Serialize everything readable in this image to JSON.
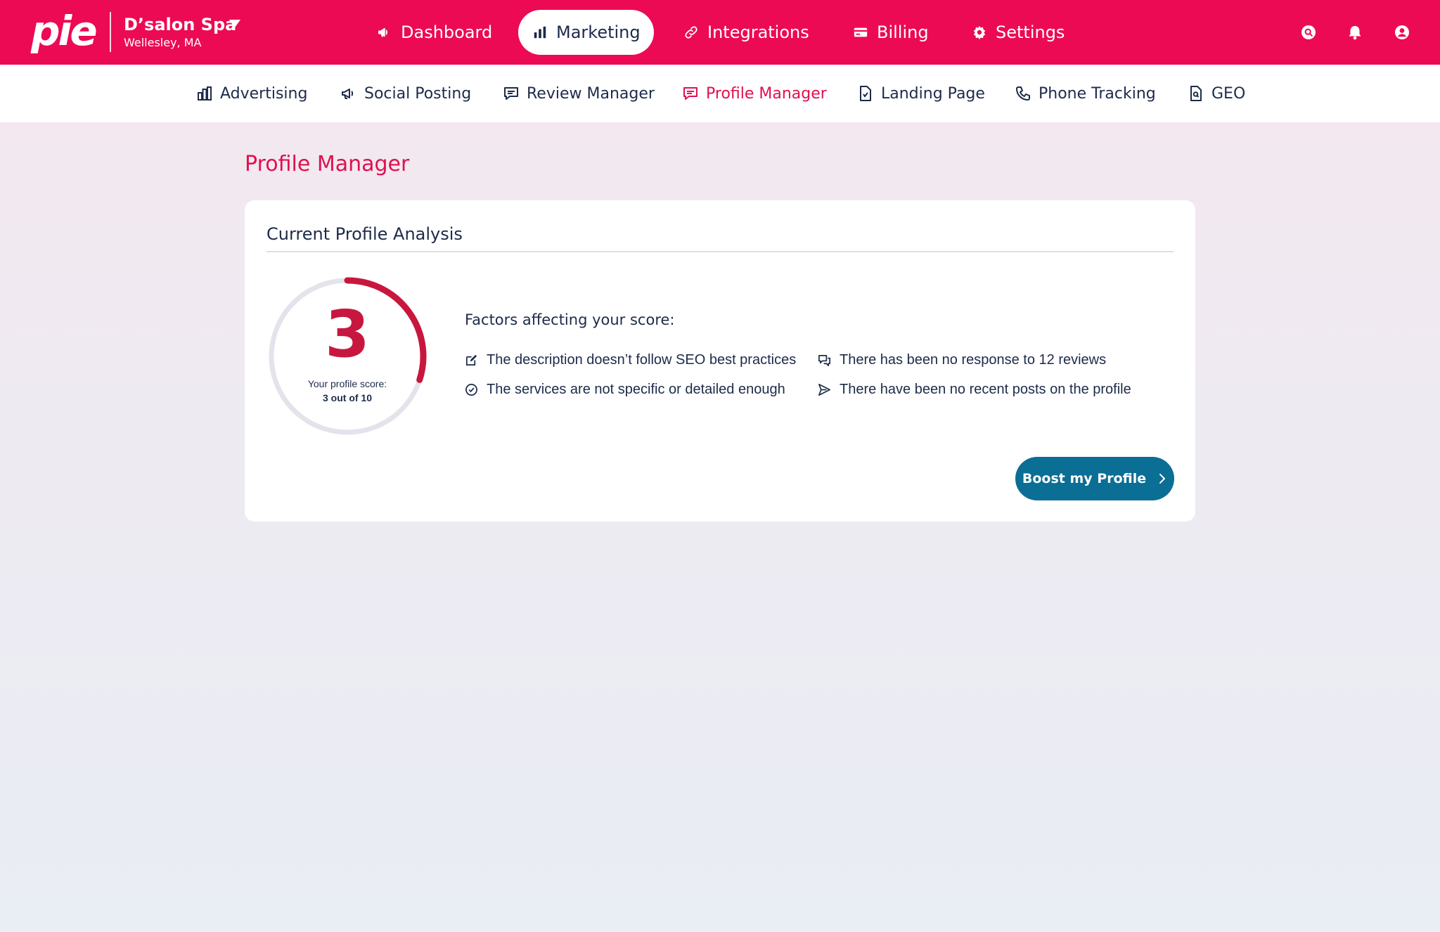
{
  "brand": {
    "logo_text": "pie"
  },
  "business": {
    "name": "D’salon Spa",
    "location": "Wellesley, MA"
  },
  "main_nav": [
    {
      "label": "Dashboard",
      "icon": "megaphone-icon",
      "active": false
    },
    {
      "label": "Marketing",
      "icon": "bar-chart-icon",
      "active": true
    },
    {
      "label": "Integrations",
      "icon": "link-icon",
      "active": false
    },
    {
      "label": "Billing",
      "icon": "credit-card-icon",
      "active": false
    },
    {
      "label": "Settings",
      "icon": "gear-icon",
      "active": false
    }
  ],
  "header_icons": [
    "search-icon",
    "bell-icon",
    "user-icon"
  ],
  "sub_nav": [
    {
      "label": "Advertising",
      "icon": "chart-icon",
      "active": false
    },
    {
      "label": "Social Posting",
      "icon": "megaphone-icon",
      "active": false
    },
    {
      "label": "Review Manager",
      "icon": "chat-icon",
      "active": false
    },
    {
      "label": "Profile Manager",
      "icon": "chat-icon",
      "active": true
    },
    {
      "label": "Landing Page",
      "icon": "document-icon",
      "active": false
    },
    {
      "label": "Phone Tracking",
      "icon": "phone-icon",
      "active": false
    },
    {
      "label": "GEO",
      "icon": "document-search-icon",
      "active": false
    }
  ],
  "page": {
    "title": "Profile Manager"
  },
  "card": {
    "title": "Current Profile Analysis",
    "score": {
      "value": "3",
      "label": "Your profile score:",
      "sub": "3 out of 10",
      "fraction": 0.3
    },
    "factors_heading": "Factors affecting your score:",
    "factors": [
      {
        "text": "The description doesn’t follow SEO best practices",
        "icon": "edit-icon"
      },
      {
        "text": "There has been no response to 12 reviews",
        "icon": "chat-bubbles-icon"
      },
      {
        "text": "The services are not specific or detailed enough",
        "icon": "check-circle-icon"
      },
      {
        "text": "There have been no recent posts on the profile",
        "icon": "send-icon"
      }
    ],
    "button_label": "Boost my Profile"
  },
  "colors": {
    "brand": "#ec0a54",
    "accent_text": "#e0104f",
    "score": "#c8173f",
    "button": "#0a6e95",
    "text": "#1d2b4a"
  }
}
